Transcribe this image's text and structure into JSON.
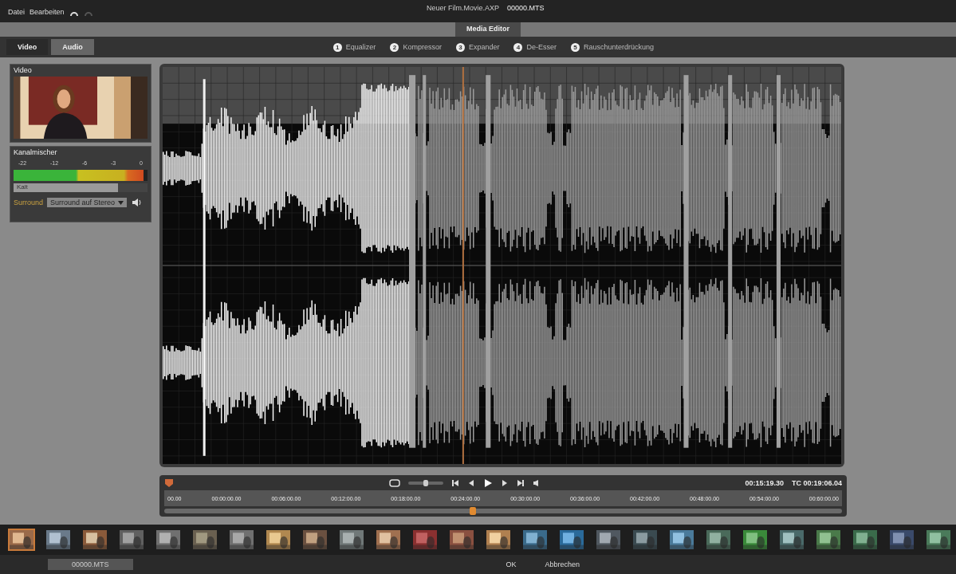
{
  "menu": [
    "Datei",
    "Bearbeiten"
  ],
  "project": {
    "title": "Neuer Film.Movie.AXP",
    "clip": "00000.MTS"
  },
  "editor_tab": "Media Editor",
  "source_tabs": [
    {
      "label": "Video",
      "selected": false
    },
    {
      "label": "Audio",
      "selected": true
    }
  ],
  "effects": [
    {
      "number": "1",
      "label": "Equalizer"
    },
    {
      "number": "2",
      "label": "Kompressor"
    },
    {
      "number": "3",
      "label": "Expander"
    },
    {
      "number": "4",
      "label": "De-Esser"
    },
    {
      "number": "5",
      "label": "Rauschunterdrückung"
    }
  ],
  "video_panel": {
    "title": "Video"
  },
  "mixer": {
    "title": "Kanalmischer",
    "scale": [
      "-22",
      "-12",
      "-6",
      "-3",
      "0"
    ],
    "meter": {
      "level": 0.97
    },
    "fader": {
      "label": "Kalt",
      "level": 0.78
    },
    "surround_label": "Surround",
    "surround_mode": "Surround auf Stereo"
  },
  "transport": {
    "duration": "00:15:19.30",
    "timecode": "TC 00:19:06.04",
    "ruler": [
      "00.00",
      "00:00:00.00",
      "00:06:00.00",
      "00:12:00.00",
      "00:18:00.00",
      "00:24:00.00",
      "00:30:00.00",
      "00:36:00.00",
      "00:42:00.00",
      "00:48:00.00",
      "00:54:00.00",
      "00:60:00.00"
    ],
    "playhead": {
      "level": 0.45
    },
    "jog": {
      "level": 0.5
    }
  },
  "filmstrip": [
    {
      "selected": true
    },
    {
      "selected": false
    },
    {
      "selected": false
    },
    {
      "selected": false
    },
    {
      "selected": false
    },
    {
      "selected": false
    },
    {
      "selected": false
    },
    {
      "selected": false
    },
    {
      "selected": false
    },
    {
      "selected": false
    },
    {
      "selected": false
    },
    {
      "selected": false
    },
    {
      "selected": false
    },
    {
      "selected": false
    },
    {
      "selected": false
    },
    {
      "selected": false
    },
    {
      "selected": false
    },
    {
      "selected": false
    },
    {
      "selected": false
    },
    {
      "selected": false
    },
    {
      "selected": false
    },
    {
      "selected": false
    },
    {
      "selected": false
    },
    {
      "selected": false
    },
    {
      "selected": false
    },
    {
      "selected": false
    }
  ],
  "footer": {
    "clip": "00000.MTS",
    "buttons": [
      "OK",
      "Abbrechen"
    ]
  }
}
